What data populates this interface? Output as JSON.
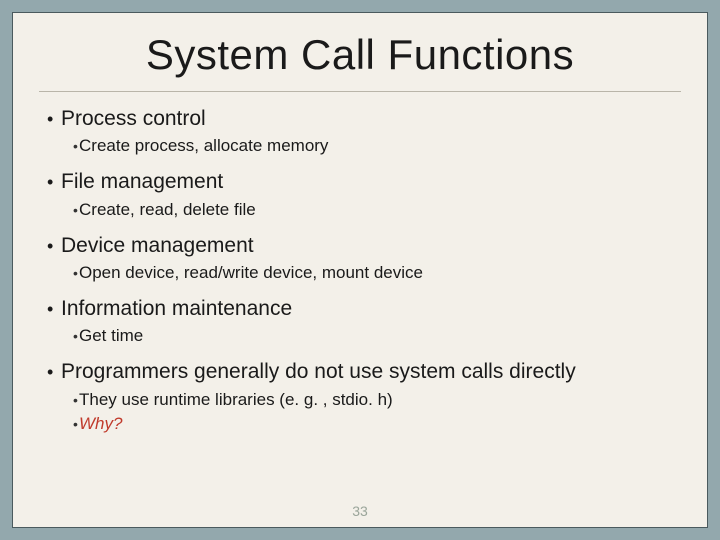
{
  "title": "System Call Functions",
  "items": [
    {
      "label": "Process control",
      "sub": [
        "Create process, allocate memory"
      ]
    },
    {
      "label": "File management",
      "sub": [
        "Create, read, delete file"
      ]
    },
    {
      "label": "Device management",
      "sub": [
        "Open device, read/write device, mount device"
      ]
    },
    {
      "label": "Information maintenance",
      "sub": [
        "Get time"
      ]
    },
    {
      "label": "Programmers generally do not use system calls directly",
      "sub": [
        "They use runtime libraries (e. g. , stdio. h)",
        "Why?"
      ],
      "whyIndex": 1
    }
  ],
  "pageNumber": "33"
}
